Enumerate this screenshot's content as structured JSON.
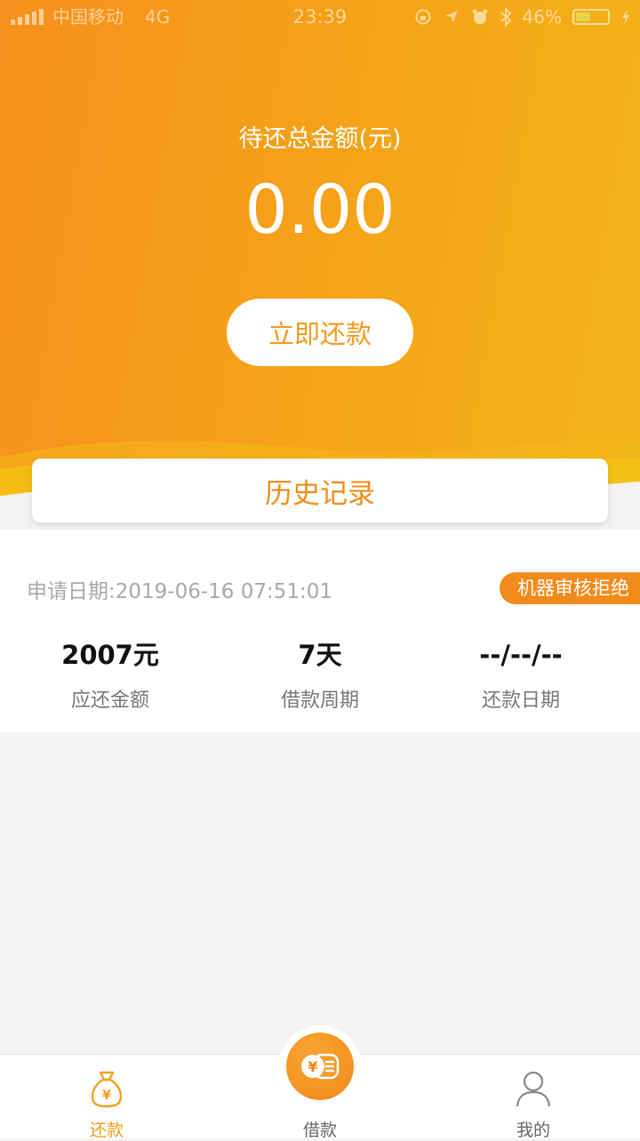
{
  "status_bar": {
    "carrier": "中国移动",
    "network": "4G",
    "time": "23:39",
    "battery": "46%",
    "battery_level": 0.46
  },
  "summary": {
    "total_label": "待还总金额(元)",
    "total_amount": "0.00",
    "repay_button": "立即还款"
  },
  "history": {
    "title": "历史记录"
  },
  "record": {
    "apply_date": "申请日期:2019-06-16 07:51:01",
    "status": "机器审核拒绝",
    "stats": [
      {
        "value": "2007元",
        "label": "应还金额"
      },
      {
        "value": "7天",
        "label": "借款周期"
      },
      {
        "value": "--/--/--",
        "label": "还款日期"
      }
    ]
  },
  "tabbar": {
    "tabs": [
      {
        "label": "还款",
        "icon": "money-bag-icon",
        "active": true
      },
      {
        "label": "借款",
        "icon": "coin-icon",
        "active": false
      },
      {
        "label": "我的",
        "icon": "user-icon",
        "active": false
      }
    ]
  },
  "colors": {
    "brand_orange": "#f28b1c",
    "active_tab": "#f0a020",
    "inactive_tab": "#666666"
  }
}
